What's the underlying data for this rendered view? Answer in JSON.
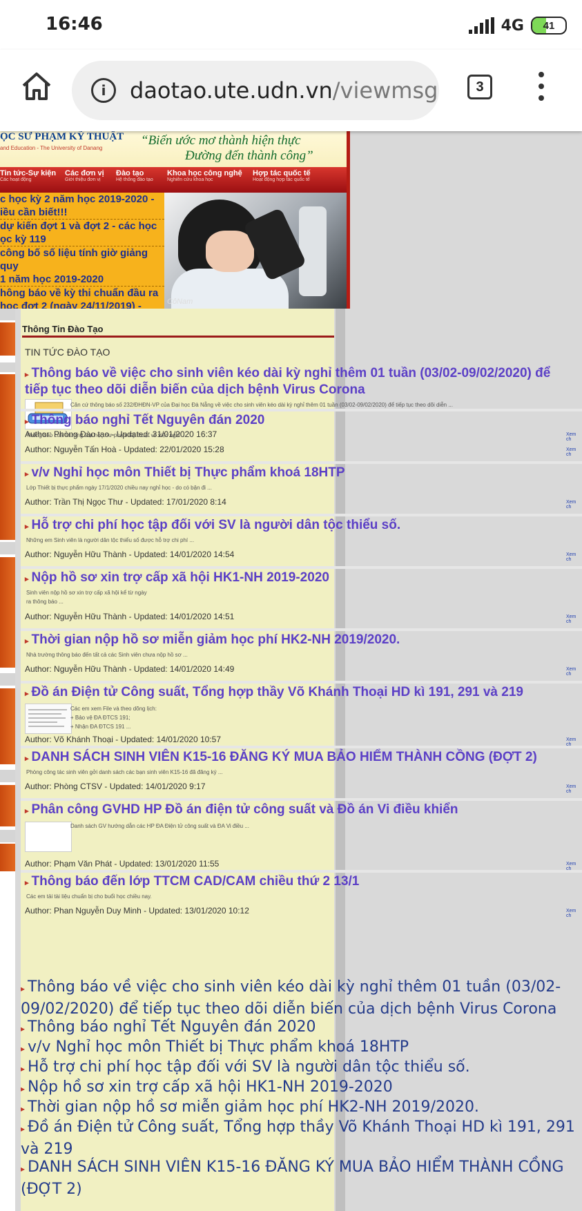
{
  "status_bar": {
    "time": "16:46",
    "network": "4G",
    "battery": "41",
    "battery_level": 0.41
  },
  "browser": {
    "url_domain": "daotao.ute.udn.vn",
    "url_path": "/viewmsg",
    "tab_count": "3"
  },
  "header": {
    "logo_line1": "ỌC SƯ PHẠM KỸ THUẬT",
    "logo_line2": "and Education - The University of Danang",
    "slogan_line1": "“Biến ước mơ thành hiện thực",
    "slogan_line2": "Đường đến thành công”",
    "nav": [
      {
        "title": "Tin tức-Sự kiện",
        "sub": "Các hoạt động"
      },
      {
        "title": "Các đơn vị",
        "sub": "Giới thiệu đơn vị"
      },
      {
        "title": "Đào tạo",
        "sub": "Hệ thống đào tạo"
      },
      {
        "title": "Khoa học công nghệ",
        "sub": "Nghiên cứu khoa học"
      },
      {
        "title": "Hợp tác quốc tế",
        "sub": "Hoạt động hợp tác quốc tế"
      }
    ],
    "ticker": [
      "c học kỳ 2 năm học 2019-2020 -",
      "iều cần biết!!!",
      "dự kiến đợt 1 và đợt 2 - các học",
      "ọc kỳ 119",
      "công bố số liệu tính giờ giảng quy",
      "1 năm học 2019-2020",
      "hông báo về kỳ thi chuẩn đầu ra",
      "học đợt 2 (ngày 24/11/2019) -"
    ],
    "photo_signature": "CôNam"
  },
  "page_title": "Thông Tin Đào Tạo",
  "section_title": "TIN TỨC ĐÀO TẠO",
  "more_label": "Xem ch",
  "articles": [
    {
      "title": "Thông báo về việc cho sinh viên kéo dài kỳ nghỉ thêm 01 tuần (03/02-09/02/2020) để tiếp tục theo dõi diễn biến của dịch bệnh Virus Corona",
      "summary": "Căn cứ thông báo số 232/ĐHĐN-VP của Đại học Đà Nẵng về việc cho sinh viên kéo dài kỳ nghỉ thêm 01 tuần (03/02-09/02/2020) để tiếp tục theo dõi diễn ...",
      "meta": "Author: Phòng Đào tạo - Updated: 31/01/2020 16:37"
    },
    {
      "title": "Thông báo nghỉ Tết Nguyên đán 2020",
      "summary": "Thông báo của Trường Đại học Sư phạm Kỹ thuật về việc nghỉ ...",
      "meta": "Author: Nguyễn Tấn Hoà - Updated: 22/01/2020 15:28"
    },
    {
      "title": "v/v Nghỉ học môn Thiết bị Thực phẩm khoá 18HTP",
      "summary": "Lớp Thiết bị thực phẩm ngày 17/1/2020 chiều nay nghỉ học - do có bận đi ...",
      "meta": "Author: Trần Thị Ngọc Thư - Updated: 17/01/2020 8:14"
    },
    {
      "title": "Hỗ trợ chi phí học tập đối với SV là người dân tộc thiểu số.",
      "summary": "Những em Sinh viên là người dân tộc thiểu số được hỗ trợ chi phí ...",
      "meta": "Author: Nguyễn Hữu Thành - Updated: 14/01/2020 14:54"
    },
    {
      "title": "Nộp hồ sơ xin trợ cấp xã hội HK1-NH 2019-2020",
      "summary": "Sinh viên nộp hồ sơ xin trợ cấp xã hội kể từ ngày\nra thông báo ...",
      "meta": "Author: Nguyễn Hữu Thành - Updated: 14/01/2020 14:51"
    },
    {
      "title": "Thời gian nộp hồ sơ miễn giảm học phí HK2-NH 2019/2020.",
      "summary": "Nhà trường thông báo đến tất cả các Sinh viên chưa nộp hồ sơ ...",
      "meta": "Author: Nguyễn Hữu Thành - Updated: 14/01/2020 14:49"
    },
    {
      "title": "Đồ án Điện tử Công suất, Tổng hợp thầy Võ Khánh Thoại HD kì 191, 291 và 219",
      "summary": "Các em xem File và theo dõng lịch:\n+ Bảo vệ ĐA ĐTCS 191;\n+ Nhận ĐA ĐTCS 191 ...",
      "meta": "Author: Võ Khánh Thoại - Updated: 14/01/2020 10:57"
    },
    {
      "title": "DANH SÁCH SINH VIÊN K15-16 ĐĂNG KÝ MUA BẢO HIỂM THÀNH CỒNG (ĐỢT 2)",
      "summary": "Phòng công tác sinh viên gởi danh sách các bạn sinh viên K15-16 đã đăng ký ...",
      "meta": "Author: Phòng CTSV - Updated: 14/01/2020 9:17"
    },
    {
      "title": "Phân công GVHD HP Đồ án điện tử công suất và Đồ án Vi điều khiển",
      "summary": "Danh sách GV hướng dẫn các HP ĐA Điện tử công suất và ĐA Vi điều ...",
      "meta": "Author: Phạm Văn Phát - Updated: 13/01/2020 11:55"
    },
    {
      "title": "Thông báo đến lớp TTCM CAD/CAM chiều thứ 2 13/1",
      "summary": "Các em tải tài liệu chuẩn bị cho buổi học chiều nay.",
      "meta": "Author: Phan Nguyễn Duy Minh - Updated: 13/01/2020 10:12"
    }
  ],
  "bottom_list": [
    "Thông báo về việc cho sinh viên kéo dài kỳ nghỉ thêm 01 tuần (03/02-09/02/2020) để tiếp tục theo dõi diễn biến của dịch bệnh Virus Corona",
    "Thông báo nghỉ Tết Nguyên đán 2020",
    "v/v Nghỉ học môn Thiết bị Thực phẩm khoá 18HTP",
    "Hỗ trợ chi phí học tập đối với SV là người dân tộc thiểu số.",
    "Nộp hồ sơ xin trợ cấp xã hội HK1-NH 2019-2020",
    "Thời gian nộp hồ sơ miễn giảm học phí HK2-NH 2019/2020.",
    "Đồ án Điện tử Công suất, Tổng hợp thầy Võ Khánh Thoại HD kì 191, 291 và 219",
    "DANH SÁCH SINH VIÊN K15-16 ĐĂNG KÝ MUA BẢO HIỂM THÀNH CỒNG (ĐỢT 2)"
  ]
}
